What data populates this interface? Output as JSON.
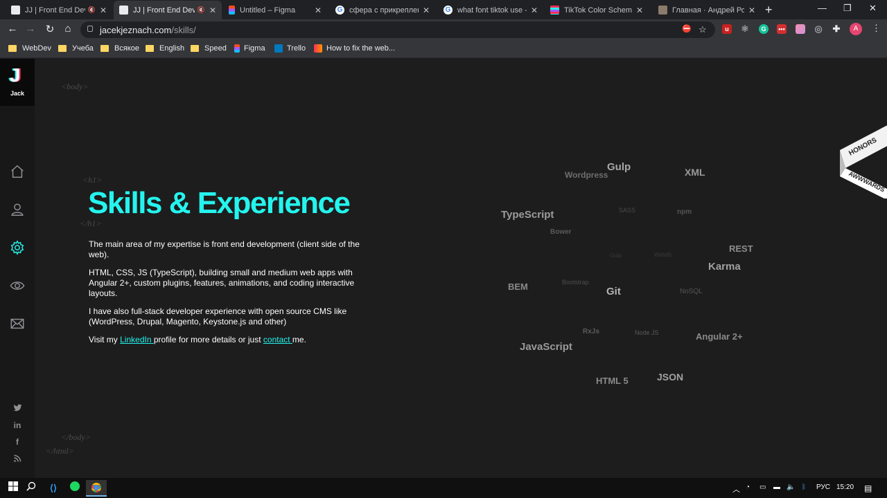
{
  "browser": {
    "tabs": [
      {
        "title": "JJ | Front End Deve",
        "muted": true
      },
      {
        "title": "JJ | Front End Deve",
        "muted": true,
        "active": true
      },
      {
        "title": "Untitled – Figma"
      },
      {
        "title": "сфера с прикрепленн"
      },
      {
        "title": "what font tiktok use - G"
      },
      {
        "title": "TikTok Color Scheme »"
      },
      {
        "title": "Главная · Андрей Ром"
      }
    ],
    "url_host": "jacekjeznach.com",
    "url_path": "/skills/",
    "profile_initial": "A",
    "bookmarks": [
      "WebDev",
      "Учеба",
      "Всякое",
      "English",
      "Speed",
      "Figma",
      "Trello",
      "How to fix the web..."
    ]
  },
  "sidebar": {
    "logo_letter": "J",
    "logo_name": "Jack"
  },
  "tags": {
    "body_open": "<body>",
    "h1_open": "<h1>",
    "h1_close": "</h1>",
    "body_close": "</body>",
    "html_close": "</html>"
  },
  "content": {
    "heading": "Skills & Experience",
    "p1": "The main area of my expertise is front end development (client side of the web).",
    "p2": "HTML, CSS, JS (TypeScript), building small and medium web apps with Angular 2+, custom plugins, features, animations, and coding interactive layouts.",
    "p3": "I have also full-stack developer experience with open source CMS like (WordPress, Drupal, Magento, Keystone.js and other)",
    "p4_before": "Visit my ",
    "p4_link1": "LinkedIn ",
    "p4_middle": "profile for more details or just ",
    "p4_link2": "contact ",
    "p4_after": "me."
  },
  "skills_cloud": [
    {
      "text": "Gulp",
      "color": "#a8a8a8"
    },
    {
      "text": "Wordpress",
      "color": "#6e6e6e"
    },
    {
      "text": "XML",
      "color": "#9a9a9a"
    },
    {
      "text": "TypeScript",
      "color": "#9c9c9c"
    },
    {
      "text": "SASS",
      "color": "#4a4a4a"
    },
    {
      "text": "npm",
      "color": "#555555"
    },
    {
      "text": "Bower",
      "color": "#5a5a5a"
    },
    {
      "text": "REST",
      "color": "#8c8c8c"
    },
    {
      "text": "Gulp",
      "color": "#3a3a3a"
    },
    {
      "text": "Webdb",
      "color": "#3a3a3a"
    },
    {
      "text": "Karma",
      "color": "#a0a0a0"
    },
    {
      "text": "BEM",
      "color": "#8a8a8a"
    },
    {
      "text": "Bootstrap",
      "color": "#4e4e4e"
    },
    {
      "text": "Git",
      "color": "#b4b4b4"
    },
    {
      "text": "NoSQL",
      "color": "#555555"
    },
    {
      "text": "RxJs",
      "color": "#5c5c5c"
    },
    {
      "text": "Node JS",
      "color": "#5a5a5a"
    },
    {
      "text": "Angular 2+",
      "color": "#8a8a8a"
    },
    {
      "text": "JavaScript",
      "color": "#9a9a9a"
    },
    {
      "text": "HTML 5",
      "color": "#8a8a8a"
    },
    {
      "text": "JSON",
      "color": "#a2a2a2"
    }
  ],
  "award": {
    "line1": "HONORS",
    "line2": "AWWWARDS"
  },
  "taskbar": {
    "lang": "РУС",
    "time": "15:20"
  },
  "colors": {
    "accent": "#25f4ee",
    "accent2": "#fe2c55",
    "page_bg": "#1d1d1d",
    "sidebar_bg": "#181818"
  }
}
